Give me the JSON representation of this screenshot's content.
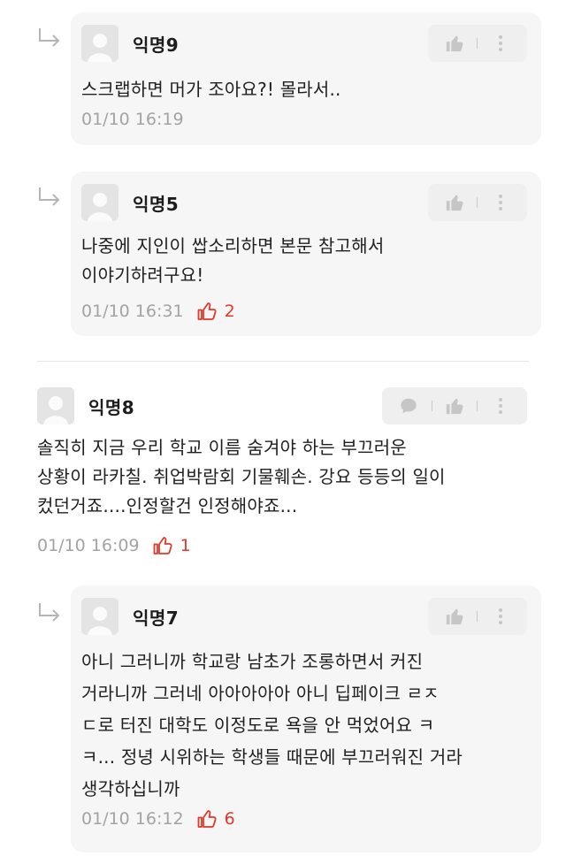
{
  "comments": [
    {
      "author": "익명9",
      "lines": [
        "스크랩하면 머가 조아요?! 몰라서.."
      ],
      "timestamp": "01/10 16:19",
      "likes": ""
    },
    {
      "author": "익명5",
      "lines": [
        "나중에 지인이 쌉소리하면 본문 참고해서",
        "이야기하려구요!"
      ],
      "timestamp": "01/10 16:31",
      "likes": "2"
    },
    {
      "author": "익명8",
      "lines": [
        "솔직히 지금 우리 학교 이름 숨겨야 하는 부끄러운",
        "상황이 라카칠. 취업박람회 기물훼손. 강요 등등의 일이",
        "컸던거죠....인정할건 인정해야죠..."
      ],
      "timestamp": "01/10 16:09",
      "likes": "1"
    },
    {
      "author": "익명7",
      "lines": [
        "아니 그러니까 학교랑 남초가 조롱하면서 커진",
        "거라니까 그러네 아아아아아 아니 딥페이크 ㄹㅈ",
        "ㄷ로 터진 대학도 이정도로 욕을 안 먹었어요 ㅋ",
        "ㅋ... 정녕 시위하는 학생들 때문에 부끄러워진 거라",
        "생각하십니까"
      ],
      "timestamp": "01/10 16:12",
      "likes": "6"
    }
  ],
  "icons": {
    "reply": "reply-arrow-icon",
    "avatar": "default-avatar-icon",
    "like": "thumbs-up-icon",
    "message": "message-bubble-icon",
    "more": "more-vertical-icon",
    "like_count": "thumbs-up-outline-icon"
  },
  "colors": {
    "bubble": "#f6f6f6",
    "like_count": "#e0392b",
    "meta": "#a3a3a3"
  }
}
